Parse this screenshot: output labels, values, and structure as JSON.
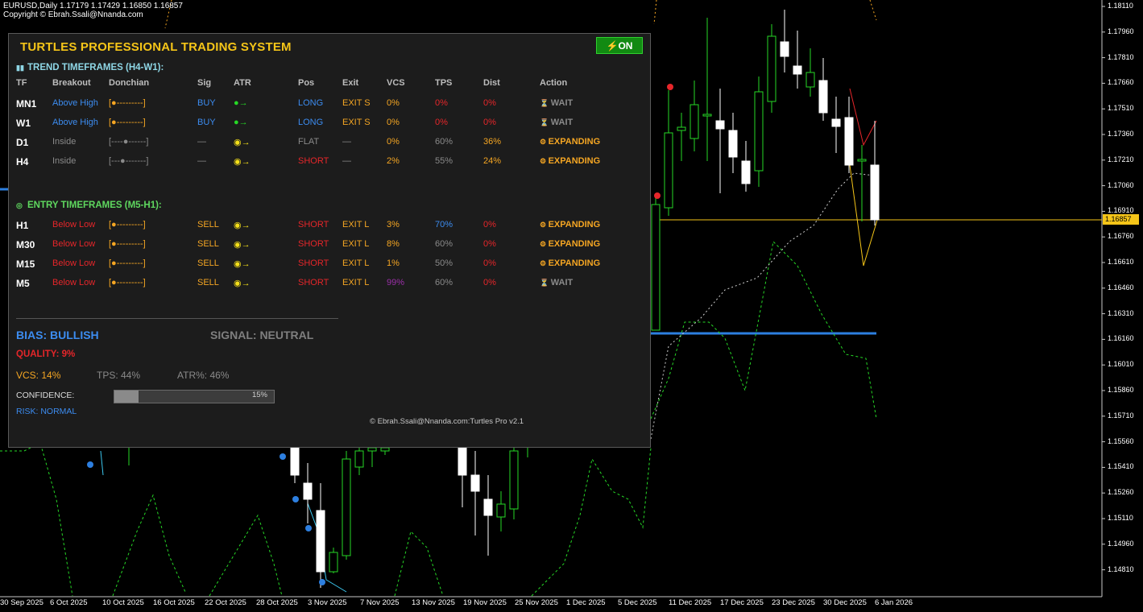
{
  "header": {
    "symbol_line": "EURUSD,Daily  1.17179 1.17429 1.16850 1.16857",
    "copyright": "Copyright © Ebrah.Ssali@Nnanda.com"
  },
  "price_axis": {
    "labels": [
      "1.18110",
      "1.17960",
      "1.17810",
      "1.17660",
      "1.17510",
      "1.17360",
      "1.17210",
      "1.17060",
      "1.16910",
      "1.16760",
      "1.16610",
      "1.16460",
      "1.16310",
      "1.16160",
      "1.16010",
      "1.15860",
      "1.15710",
      "1.15560",
      "1.15410",
      "1.15260",
      "1.15110",
      "1.14960",
      "1.14810"
    ],
    "current_price": "1.16857",
    "current_price_color": "#f5c518"
  },
  "time_axis": {
    "labels": [
      "30 Sep 2025",
      "6 Oct 2025",
      "10 Oct 2025",
      "16 Oct 2025",
      "22 Oct 2025",
      "28 Oct 2025",
      "3 Nov 2025",
      "7 Nov 2025",
      "13 Nov 2025",
      "19 Nov 2025",
      "25 Nov 2025",
      "1 Dec 2025",
      "5 Dec 2025",
      "11 Dec 2025",
      "17 Dec 2025",
      "23 Dec 2025",
      "30 Dec 2025",
      "6 Jan 2026"
    ]
  },
  "panel": {
    "title": "TURTLES PROFESSIONAL TRADING SYSTEM",
    "on_button": "⚡ON",
    "trend_section": "TREND TIMEFRAMES (H4-W1):",
    "entry_section": "ENTRY TIMEFRAMES (M5-H1):",
    "columns": [
      "TF",
      "Breakout",
      "Donchian",
      "Sig",
      "ATR",
      "Pos",
      "Exit",
      "VCS",
      "TPS",
      "Dist",
      "Action"
    ],
    "trend_rows": [
      {
        "tf": "MN1",
        "breakout": "Above High",
        "donchian": "[●---------]",
        "sig": "BUY",
        "atr": "●→",
        "pos": "LONG",
        "exit": "EXIT S",
        "vcs": "0%",
        "tps": "0%",
        "dist": "0%",
        "action": "WAIT"
      },
      {
        "tf": "W1",
        "breakout": "Above High",
        "donchian": "[●---------]",
        "sig": "BUY",
        "atr": "●→",
        "pos": "LONG",
        "exit": "EXIT S",
        "vcs": "0%",
        "tps": "0%",
        "dist": "0%",
        "action": "WAIT"
      },
      {
        "tf": "D1",
        "breakout": "Inside",
        "donchian": "[----●------]",
        "sig": "—",
        "atr": "◉→",
        "pos": "FLAT",
        "exit": "—",
        "vcs": "0%",
        "tps": "60%",
        "dist": "36%",
        "action": "EXPANDING"
      },
      {
        "tf": "H4",
        "breakout": "Inside",
        "donchian": "[---●-------]",
        "sig": "—",
        "atr": "◉→",
        "pos": "SHORT",
        "exit": "—",
        "vcs": "2%",
        "tps": "55%",
        "dist": "24%",
        "action": "EXPANDING"
      }
    ],
    "entry_rows": [
      {
        "tf": "H1",
        "breakout": "Below Low",
        "donchian": "[●---------]",
        "sig": "SELL",
        "atr": "◉→",
        "pos": "SHORT",
        "exit": "EXIT L",
        "vcs": "3%",
        "tps": "70%",
        "dist": "0%",
        "action": "EXPANDING"
      },
      {
        "tf": "M30",
        "breakout": "Below Low",
        "donchian": "[●---------]",
        "sig": "SELL",
        "atr": "◉→",
        "pos": "SHORT",
        "exit": "EXIT L",
        "vcs": "8%",
        "tps": "60%",
        "dist": "0%",
        "action": "EXPANDING"
      },
      {
        "tf": "M15",
        "breakout": "Below Low",
        "donchian": "[●---------]",
        "sig": "SELL",
        "atr": "◉→",
        "pos": "SHORT",
        "exit": "EXIT L",
        "vcs": "1%",
        "tps": "50%",
        "dist": "0%",
        "action": "EXPANDING"
      },
      {
        "tf": "M5",
        "breakout": "Below Low",
        "donchian": "[●---------]",
        "sig": "SELL",
        "atr": "◉→",
        "pos": "SHORT",
        "exit": "EXIT L",
        "vcs": "99%",
        "tps": "60%",
        "dist": "0%",
        "action": "WAIT"
      }
    ],
    "bias": "BIAS: BULLISH",
    "signal": "SIGNAL: NEUTRAL",
    "quality": "QUALITY: 9%",
    "vcs": "VCS: 14%",
    "tps": "TPS: 44%",
    "atr_pct": "ATR%: 46%",
    "confidence_label": "CONFIDENCE:",
    "confidence_value": 15,
    "confidence_text": "15%",
    "risk": "RISK: NORMAL",
    "footer": "© Ebrah.Ssali@Nnanda.com:Turtles Pro v2.1"
  },
  "colors": {
    "title": "#f5c518",
    "bullish": "#3c8cf0",
    "bearish": "#e6262a",
    "on_green": "#128a12",
    "candle_up": "#26d826",
    "candle_down": "#ffffff",
    "support_line": "#2d7fe0"
  }
}
